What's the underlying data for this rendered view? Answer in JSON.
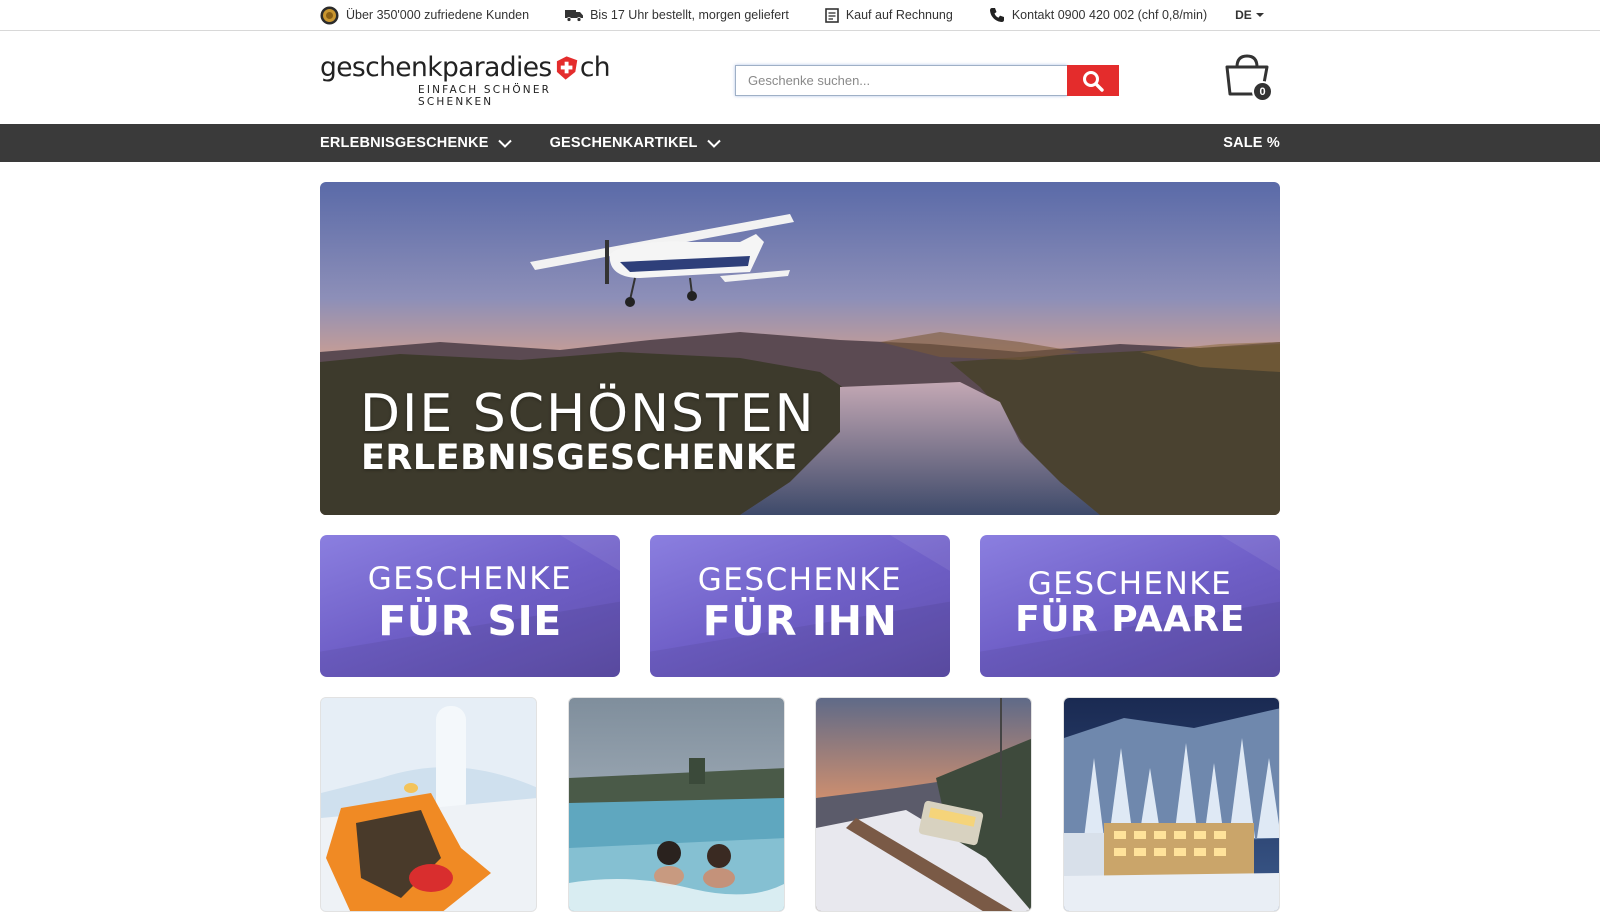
{
  "topbar": {
    "customers": "Über 350'000 zufriedene Kunden",
    "delivery": "Bis 17 Uhr bestellt, morgen geliefert",
    "invoice": "Kauf auf Rechnung",
    "contact": "Kontakt 0900 420 002  (chf 0,8/min)",
    "language": "DE"
  },
  "header": {
    "logo_main_left": "geschenkparadies",
    "logo_main_right": "ch",
    "logo_sub": "EINFACH SCHÖNER SCHENKEN",
    "search_placeholder": "Geschenke suchen...",
    "cart_count": "0"
  },
  "nav": {
    "items": [
      {
        "label": "ERLEBNISGESCHENKE"
      },
      {
        "label": "GESCHENKARTIKEL"
      }
    ],
    "sale": "SALE %"
  },
  "hero": {
    "title": "DIE SCHÖNSTEN",
    "subtitle": "ERLEBNISGESCHENKE"
  },
  "tiles": [
    {
      "line1": "GESCHENKE",
      "line2": "FÜR SIE"
    },
    {
      "line1": "GESCHENKE",
      "line2": "FÜR IHN"
    },
    {
      "line1": "GESCHENKE",
      "line2": "FÜR PAARE"
    }
  ],
  "colors": {
    "accent_red": "#e42c2c",
    "nav_bg": "#3a3a3a",
    "tile_purple": "#6f5fc7"
  },
  "icons": [
    "medal-icon",
    "truck-icon",
    "invoice-icon",
    "phone-icon",
    "swiss-shield-icon",
    "search-icon",
    "shopping-bag-icon",
    "chevron-down-icon"
  ]
}
